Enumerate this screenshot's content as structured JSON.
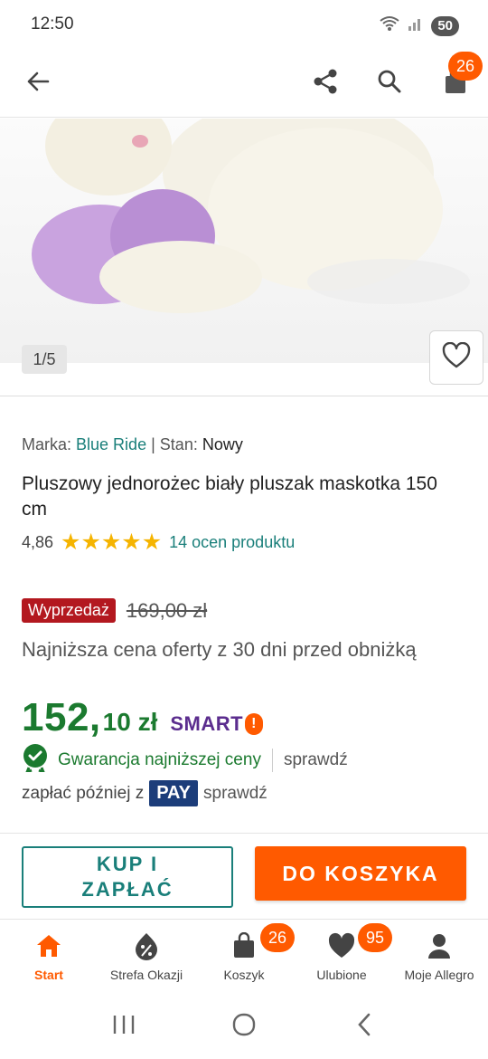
{
  "status_bar": {
    "time": "12:50",
    "battery": "50"
  },
  "header": {
    "cart_badge": "26"
  },
  "gallery": {
    "counter": "1/5"
  },
  "product": {
    "brand_label": "Marka:",
    "brand": "Blue Ride",
    "separator": "|",
    "condition_label": "Stan:",
    "condition": "Nowy",
    "title": "Pluszowy jednorożec biały pluszak maskotka 150 cm",
    "rating": "4,86",
    "stars": "★★★★★",
    "stars_value": 5,
    "reviews": "14 ocen produktu"
  },
  "pricing": {
    "sale_label": "Wyprzedaż",
    "old_price": "169,00 zł",
    "lowest_note": "Najniższa cena oferty z 30 dni przed obniżką",
    "price_main": "152,",
    "price_frac": "10 zł",
    "smart_label": "SMART",
    "smart_icon": "!",
    "guarantee": "Gwarancja najniższej ceny",
    "guarantee_check": "sprawdź",
    "pay_later": "zapłać później z",
    "pay_badge": "PAY",
    "pay_check": "sprawdź"
  },
  "actions": {
    "buy_line1": "KUP I",
    "buy_line2": "ZAPŁAĆ",
    "add_to_cart": "DO KOSZYKA"
  },
  "bottom_nav": {
    "items": [
      {
        "label": "Start",
        "icon": "home-icon",
        "active": true
      },
      {
        "label": "Strefa Okazji",
        "icon": "percent-bag-icon"
      },
      {
        "label": "Koszyk",
        "icon": "bag-icon",
        "badge": "26"
      },
      {
        "label": "Ulubione",
        "icon": "heart-icon",
        "badge": "95"
      },
      {
        "label": "Moje Allegro",
        "icon": "user-icon"
      }
    ]
  },
  "colors": {
    "accent": "#ff5a00",
    "teal": "#1a7f7a",
    "price_green": "#1b7a2f",
    "sale_red": "#b3181f",
    "pay_blue": "#1c3d7a"
  }
}
